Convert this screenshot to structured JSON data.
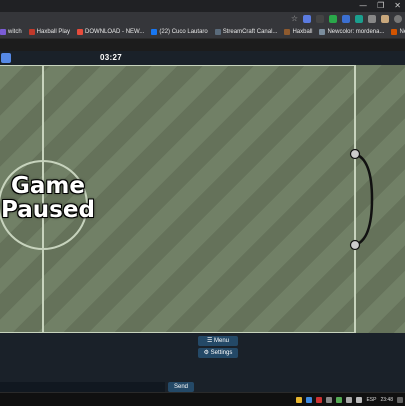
{
  "window": {
    "controls": [
      "—",
      "❐",
      "✕"
    ]
  },
  "bookmarks": [
    {
      "label": "witch",
      "color": "#7b5cd6"
    },
    {
      "label": "Haxball Play",
      "color": "#c0392b"
    },
    {
      "label": "DOWNLOAD - NEW...",
      "color": "#e74c3c"
    },
    {
      "label": "(22) Cuco Lautaro",
      "color": "#1877f2"
    },
    {
      "label": "StreamCraft Canal...",
      "color": "#5a6b7b"
    },
    {
      "label": "Haxball",
      "color": "#8e5a2e"
    },
    {
      "label": "Newcolor: mordena...",
      "color": "#7b8d9d"
    },
    {
      "label": "Nessunem | Reanne...",
      "color": "#d35400"
    }
  ],
  "game": {
    "timer": "03:27",
    "team_color": "#5689e5",
    "paused_line1": "Game",
    "paused_line2": "Paused"
  },
  "panel": {
    "menu_label": "☰ Menu",
    "settings_label": "⚙ Settings",
    "send_label": "Send",
    "chat_placeholder": ""
  },
  "taskbar": {
    "lang": "ESP",
    "time": "23:48"
  }
}
